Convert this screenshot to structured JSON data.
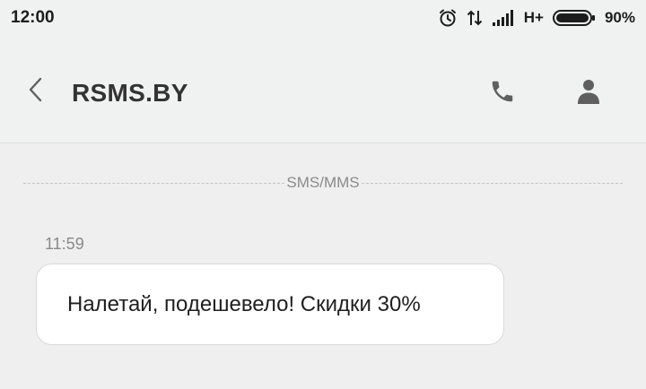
{
  "status_bar": {
    "time": "12:00",
    "network": "H+",
    "battery_percent": "90%",
    "battery_level": 0.9,
    "icons": [
      "alarm-icon",
      "data-transfer-icon",
      "signal-icon",
      "battery-icon"
    ]
  },
  "toolbar": {
    "title": "RSMS.BY",
    "icons": [
      "back-icon",
      "phone-icon",
      "contact-icon"
    ]
  },
  "conversation": {
    "divider_label": "SMS/MMS",
    "messages": [
      {
        "time": "11:59",
        "text": "Налетай, подешевело! Скидки 30%"
      }
    ]
  },
  "colors": {
    "background": "#efefef",
    "bubble": "#ffffff",
    "icon": "#5f5f5f"
  }
}
